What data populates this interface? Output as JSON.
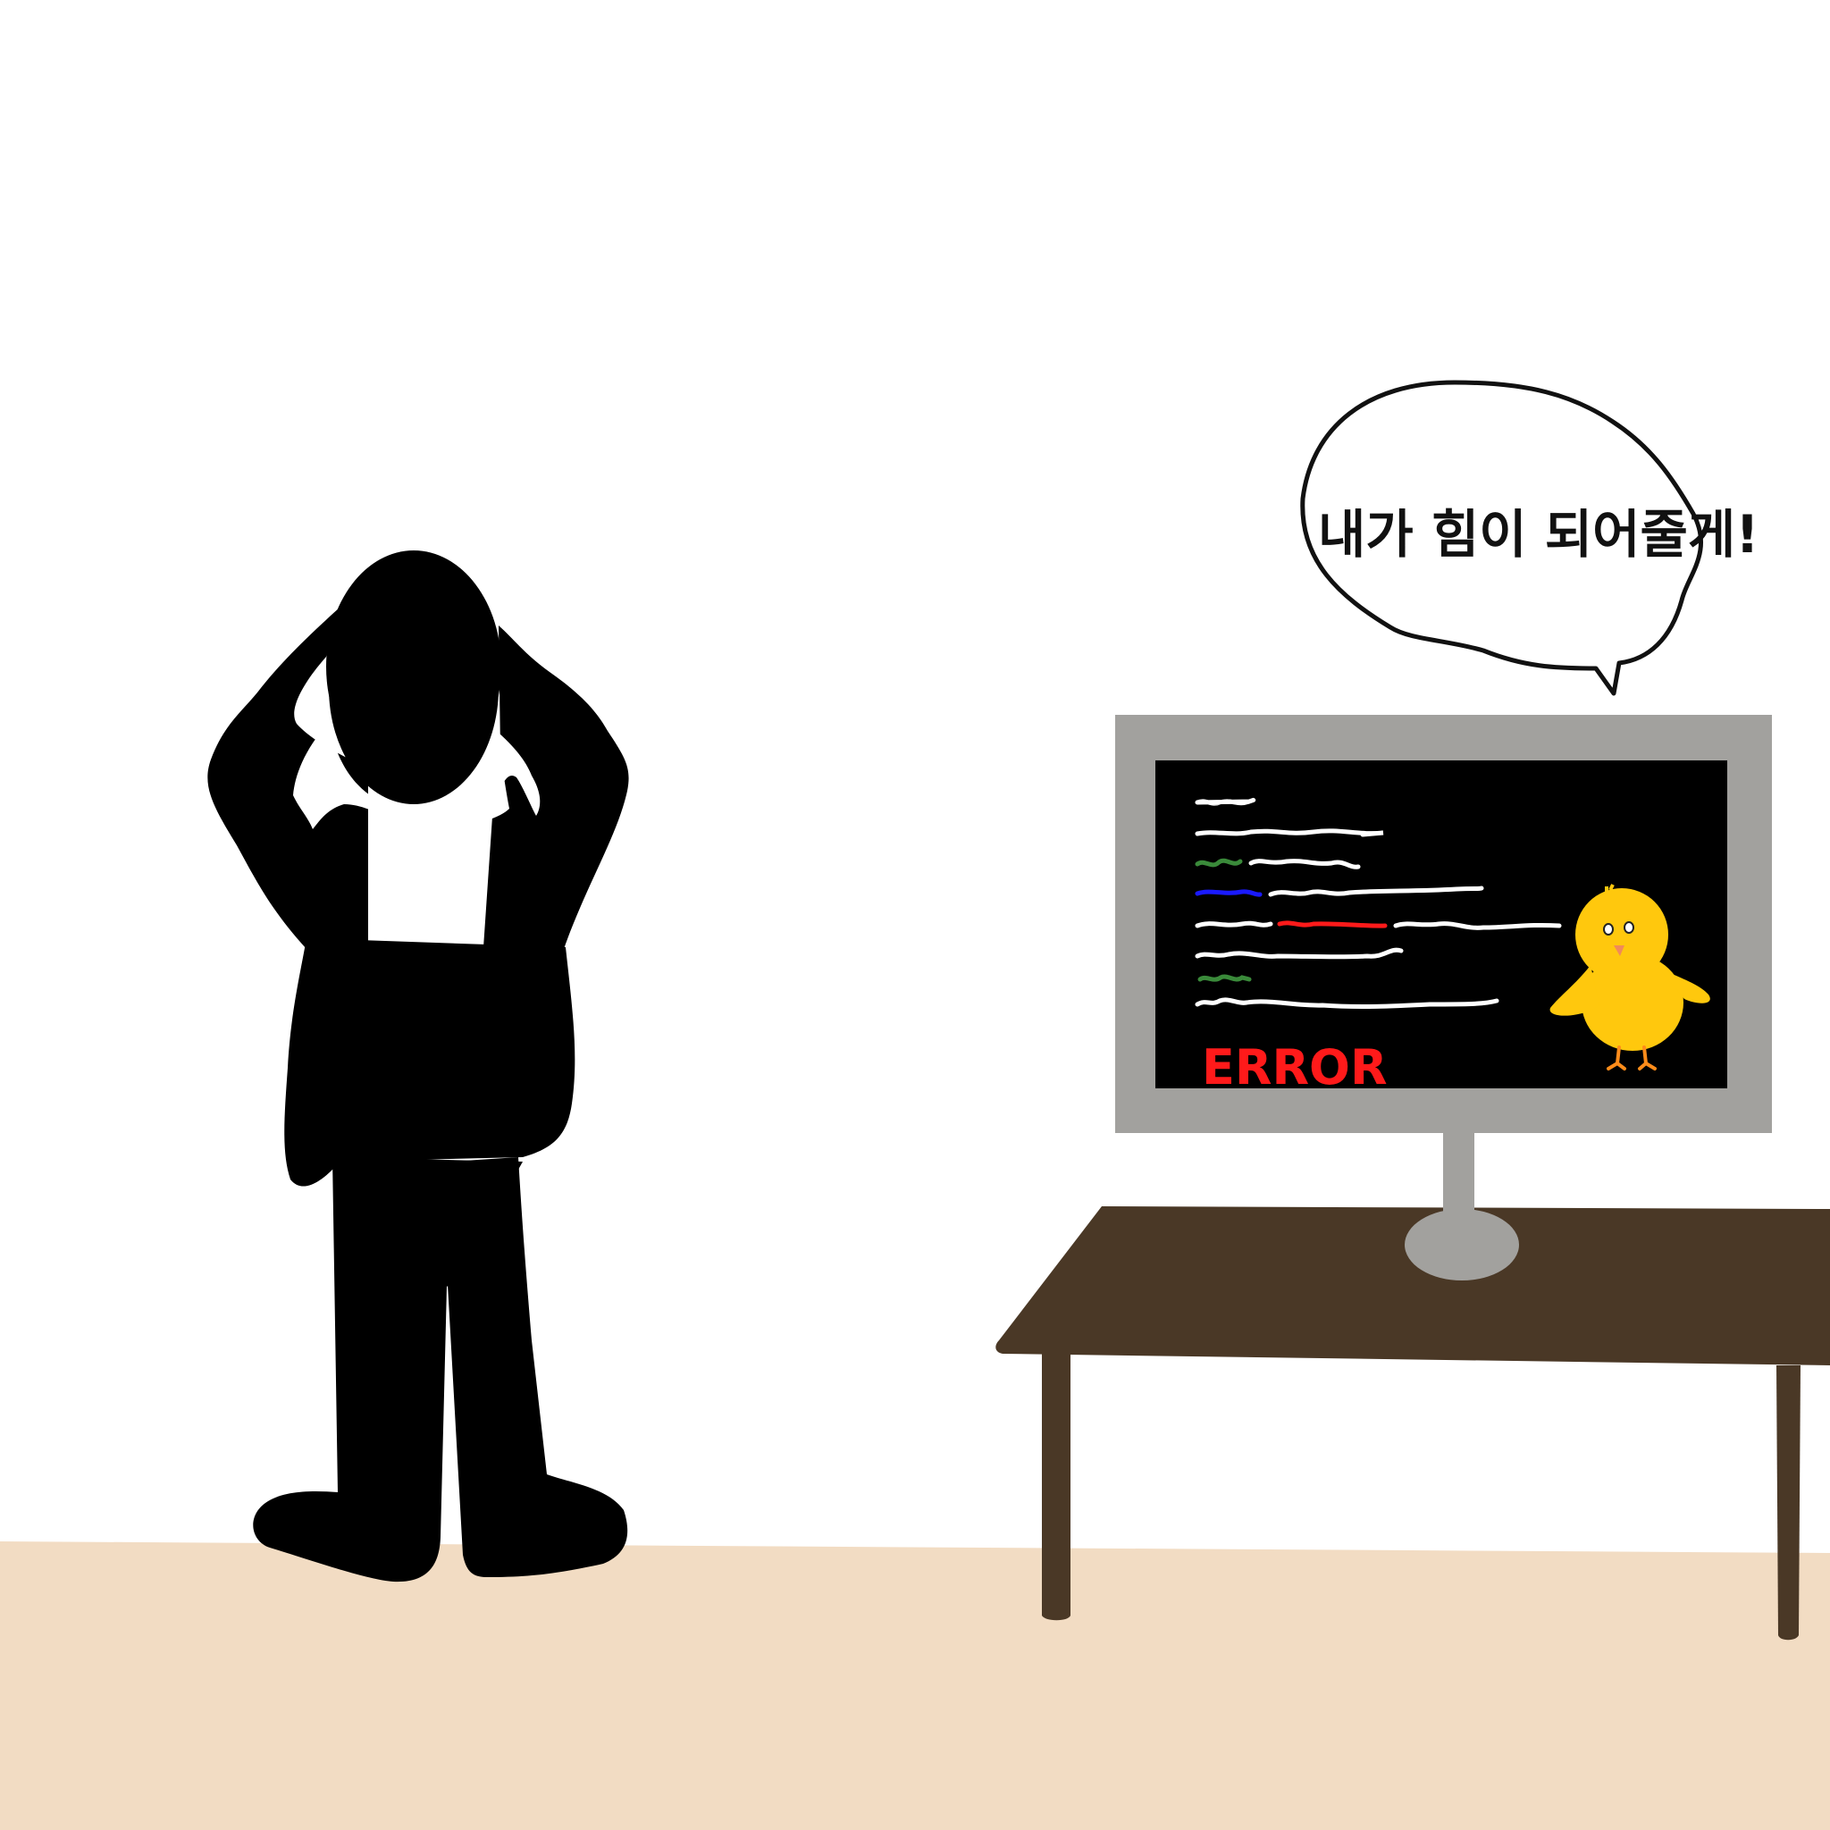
{
  "speech_bubble": {
    "text": "내가 힘이 되어줄게!"
  },
  "monitor": {
    "error_label": "ERROR"
  },
  "colors": {
    "background": "#ffffff",
    "floor": "#f2dcc3",
    "silhouette": "#000000",
    "desk": "#4a3826",
    "monitor_frame": "#a2a19e",
    "screen": "#000000",
    "chick": "#ffc80d",
    "error": "#ff1a1a",
    "code_white": "#ffffff",
    "code_green": "#3a8a3a",
    "code_blue": "#1a1aff",
    "code_red": "#ff1a1a"
  }
}
